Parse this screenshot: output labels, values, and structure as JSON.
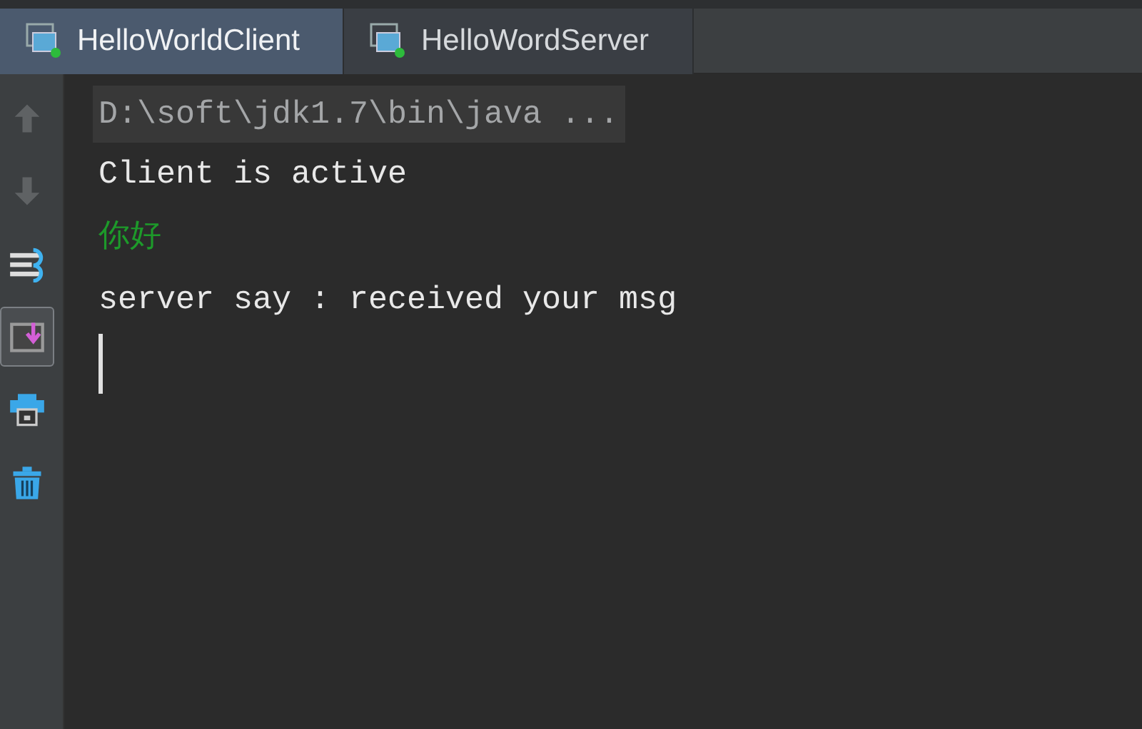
{
  "tabs": [
    {
      "label": "HelloWorldClient",
      "selected": true
    },
    {
      "label": "HelloWordServer",
      "selected": false
    }
  ],
  "toolbar": [
    {
      "kind": "up",
      "disabled": true,
      "selected": false
    },
    {
      "kind": "down",
      "disabled": true,
      "selected": false
    },
    {
      "kind": "wrap",
      "disabled": false,
      "selected": false
    },
    {
      "kind": "scroll",
      "disabled": false,
      "selected": true
    },
    {
      "kind": "print",
      "disabled": false,
      "selected": false
    },
    {
      "kind": "trash",
      "disabled": false,
      "selected": false
    }
  ],
  "console": {
    "lines": [
      {
        "kind": "command",
        "text": "D:\\soft\\jdk1.7\\bin\\java ..."
      },
      {
        "kind": "output",
        "text": "Client is active"
      },
      {
        "kind": "input",
        "text": "你好"
      },
      {
        "kind": "output",
        "text": "server say : received your msg"
      }
    ]
  }
}
